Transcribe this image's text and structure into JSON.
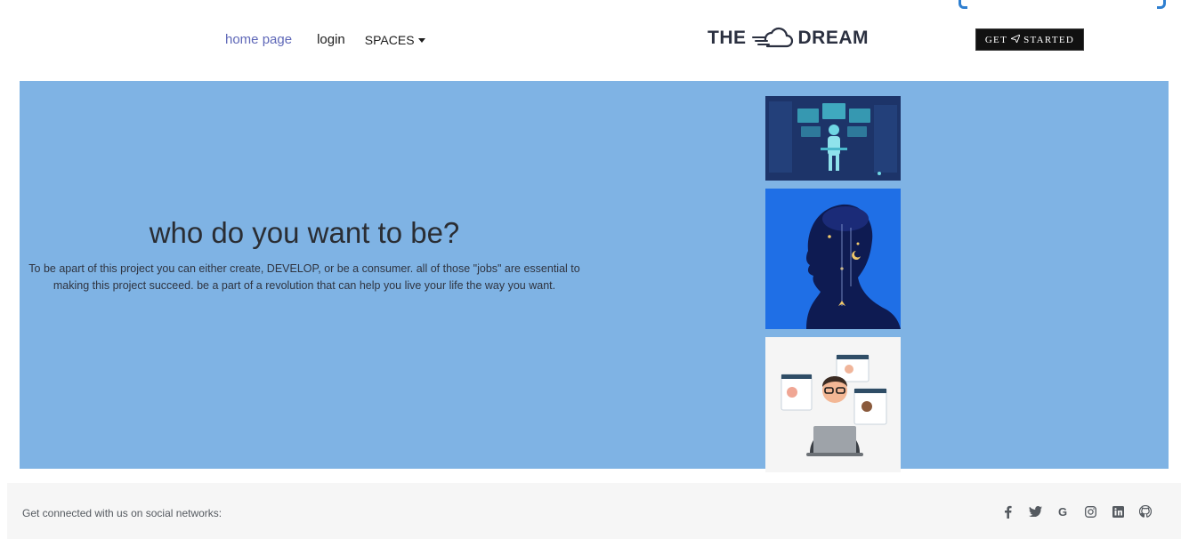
{
  "nav": {
    "links": [
      {
        "label": "home page"
      },
      {
        "label": "login"
      },
      {
        "label": "SPACES"
      }
    ]
  },
  "brand": {
    "left": "THE",
    "right": "DREAM",
    "icon": "cloud-wind-icon"
  },
  "cta": {
    "left": "GET",
    "right": "STARTED",
    "icon": "paper-plane-icon"
  },
  "hero": {
    "title": "who do you want to be?",
    "description": "To be apart of this project you can either create, DEVELOP, or be a consumer. all of those \"jobs\" are essential to making this project succeed. be a part of a revolution that can help you live your life the way you want.",
    "background": "#7fb3e4"
  },
  "footer": {
    "text": "Get connected with us on social networks:",
    "icons": [
      "facebook-icon",
      "twitter-icon",
      "google-icon",
      "instagram-icon",
      "linkedin-icon",
      "github-icon"
    ],
    "google_glyph": "G"
  },
  "colors": {
    "accent_link": "#5f68b8",
    "brand_text": "#2b3040",
    "cta_bg": "#111111"
  }
}
